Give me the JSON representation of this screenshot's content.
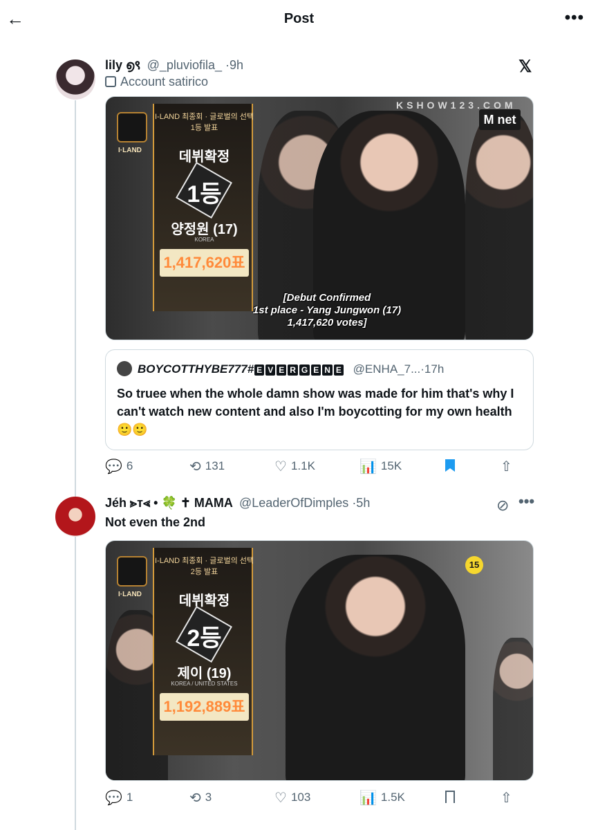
{
  "topbar": {
    "back_icon": "←",
    "title": "Post",
    "more_icon": "•••"
  },
  "post1": {
    "name": "lily ൭९",
    "handle": "@_pluviofila_",
    "time": "·9h",
    "x_logo": "𝕏",
    "label": "Account satirico",
    "media": {
      "watermark": "KSHOW123.COM",
      "network": "M net",
      "rank_top": "I-LAND 최종회 · 글로벌의 선택 1등 발표",
      "brand": "I·LAND",
      "rank_head": "데뷔확정",
      "rank_num": "1등",
      "rank_name": "양정원 (17)",
      "country": "KOREA",
      "votes": "1,417,620표",
      "subtitle_1": "[Debut Confirmed",
      "subtitle_2": "1st place - Yang Jungwon (17)",
      "subtitle_3": "1,417,620 votes]"
    },
    "quote": {
      "name_prefix": "BOYCOTTHYBE777#",
      "badges": [
        "E",
        "V",
        "E",
        "R",
        "G",
        "E",
        "N",
        "E"
      ],
      "handle": "@ENHA_7...",
      "time": "·17h",
      "text": "So truee when the whole damn show was made for him that's why I can't watch new content and also I'm boycotting for my own health 🙂🙂"
    },
    "actions": {
      "replies": "6",
      "reposts": "131",
      "likes": "1.1K",
      "views": "15K"
    }
  },
  "post2": {
    "name": "Jéh ⪢ᴛ⪡ • 🍀 ✝ MAMA",
    "handle": "@LeaderOfDimples",
    "time": "·5h",
    "text": "Not even the 2nd",
    "media": {
      "rank_top": "I-LAND 최종회 · 글로벌의 선택 2등 발표",
      "brand": "I·LAND",
      "rank_head": "데뷔확정",
      "rank_num": "2등",
      "rank_name": "제이 (19)",
      "country": "KOREA / UNITED STATES",
      "votes": "1,192,889표",
      "age_badge": "15"
    },
    "actions": {
      "replies": "1",
      "reposts": "3",
      "likes": "103",
      "views": "1.5K"
    }
  },
  "icons": {
    "reply": "💬",
    "repost": "⟲",
    "like": "♡",
    "views": "📊",
    "share": "⇧"
  }
}
